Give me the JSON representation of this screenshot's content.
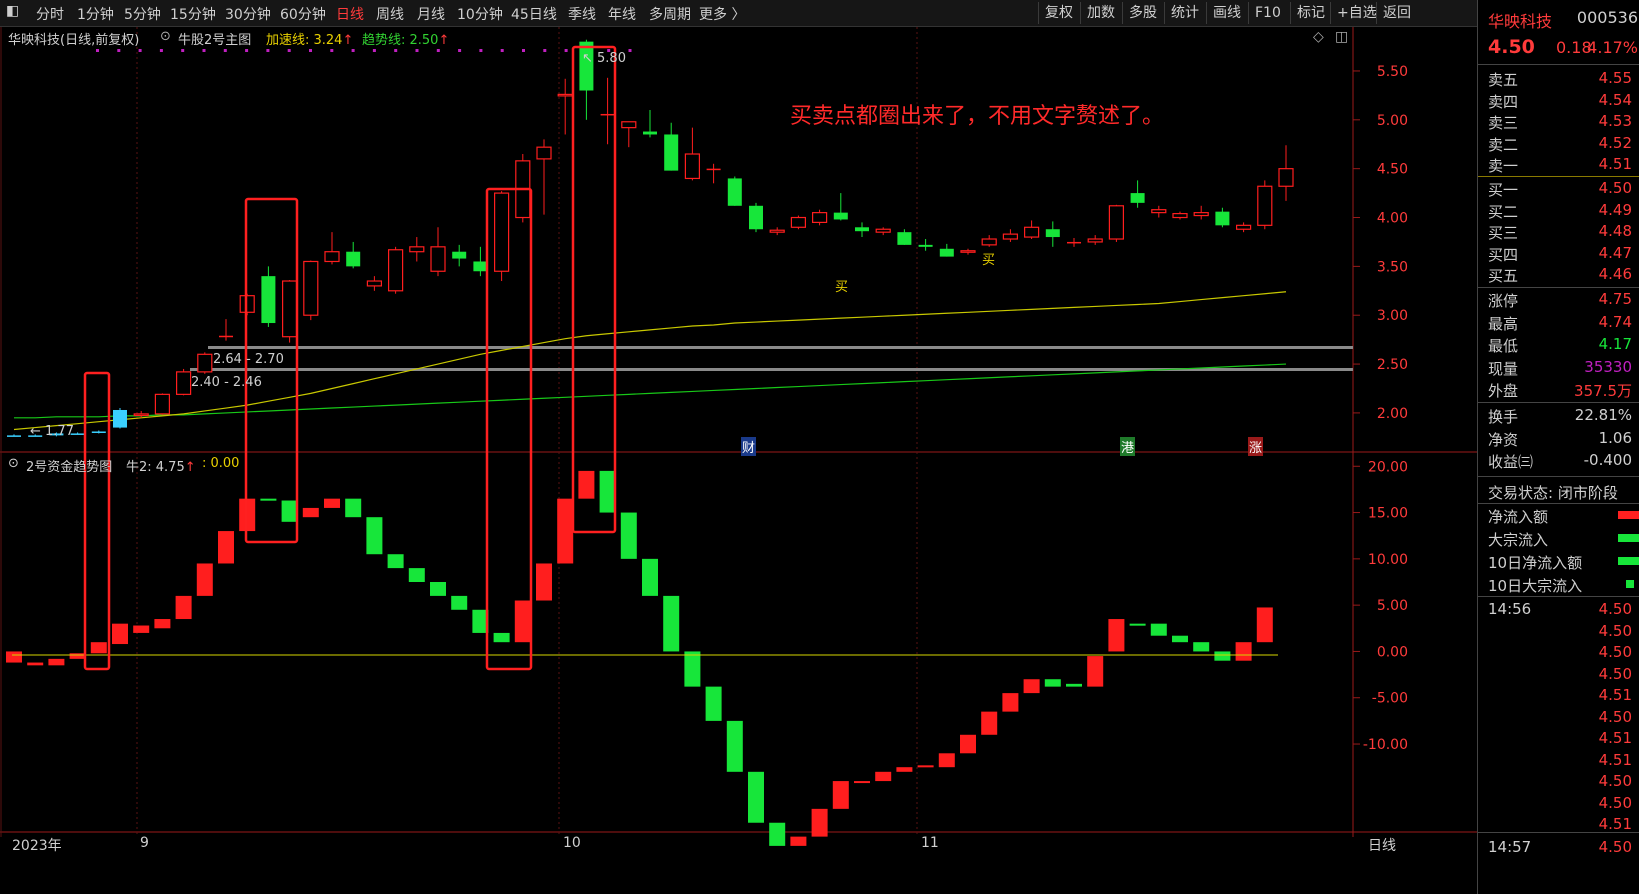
{
  "toolbar": {
    "periods": [
      "分时",
      "1分钟",
      "5分钟",
      "15分钟",
      "30分钟",
      "60分钟",
      "日线",
      "周线",
      "月线",
      "10分钟",
      "45日线",
      "季线",
      "年线",
      "多周期",
      "更多 〉"
    ],
    "active": "日线",
    "right_buttons": [
      "复权",
      "加数",
      "多股",
      "统计",
      "画线",
      "F10",
      "标记",
      "+自选",
      "返回"
    ]
  },
  "main_chart": {
    "title": "华映科技(日线,前复权)",
    "indicator": "牛股2号主图",
    "accel_label": "加速线: 3.24",
    "trend_label": "趋势线: 2.50",
    "annotation": "买卖点都圈出来了，不用文字赘述了。",
    "zone_upper": "2.64 - 2.70",
    "zone_lower": "2.40 - 2.46",
    "high_label": "5.80",
    "low_label": "1.77",
    "buy_marks": [
      "买",
      "买"
    ],
    "event_marks": [
      "财",
      "港",
      "涨"
    ],
    "y_ticks": [
      "5.50",
      "5.00",
      "4.50",
      "4.00",
      "3.50",
      "3.00",
      "2.50",
      "2.00"
    ]
  },
  "sub_chart": {
    "title": "2号资金趋势图",
    "value": "牛2: 4.75",
    "extra": ": 0.00",
    "y_ticks": [
      "20.00",
      "15.00",
      "10.00",
      "5.00",
      "0.00",
      "-5.00",
      "-10.00"
    ]
  },
  "x_axis": {
    "labels": [
      "2023年",
      "9",
      "10",
      "11"
    ],
    "period": "日线"
  },
  "quote": {
    "name": "华映科技",
    "code": "000536",
    "price": "4.50",
    "change": "0.18",
    "pct": "4.17%",
    "asks": [
      [
        "卖五",
        "4.55"
      ],
      [
        "卖四",
        "4.54"
      ],
      [
        "卖三",
        "4.53"
      ],
      [
        "卖二",
        "4.52"
      ],
      [
        "卖一",
        "4.51"
      ]
    ],
    "bids": [
      [
        "买一",
        "4.50"
      ],
      [
        "买二",
        "4.49"
      ],
      [
        "买三",
        "4.48"
      ],
      [
        "买四",
        "4.47"
      ],
      [
        "买五",
        "4.46"
      ]
    ],
    "stats": [
      [
        "涨停",
        "4.75"
      ],
      [
        "最高",
        "4.74"
      ],
      [
        "最低",
        "4.17"
      ],
      [
        "现量",
        "35330"
      ],
      [
        "外盘",
        "357.5万"
      ]
    ],
    "stats2": [
      [
        "换手",
        "22.81%"
      ],
      [
        "净资",
        "1.06"
      ],
      [
        "收益㈢",
        "-0.400"
      ]
    ],
    "status": "交易状态: 闭市阶段",
    "legend": [
      "净流入额",
      "大宗流入",
      "10日净流入额",
      "10日大宗流入"
    ],
    "ticks": [
      [
        "14:56",
        "4.50"
      ],
      [
        "",
        "4.50"
      ],
      [
        "",
        "4.50"
      ],
      [
        "",
        "4.50"
      ],
      [
        "",
        "4.51"
      ],
      [
        "",
        "4.50"
      ],
      [
        "",
        "4.51"
      ],
      [
        "",
        "4.51"
      ],
      [
        "",
        "4.50"
      ],
      [
        "",
        "4.50"
      ],
      [
        "",
        "4.51"
      ]
    ],
    "last_tick": [
      "14:57",
      "4.50"
    ]
  },
  "chart_data": {
    "type": "candlestick",
    "ylim": [
      1.6,
      5.95
    ],
    "candles": [
      [
        1.77,
        1.78,
        1.76,
        1.77
      ],
      [
        1.77,
        1.78,
        1.76,
        1.77
      ],
      [
        1.77,
        1.8,
        1.76,
        1.79
      ],
      [
        1.79,
        1.8,
        1.78,
        1.79
      ],
      [
        1.8,
        1.82,
        1.79,
        1.81
      ],
      [
        1.85,
        2.05,
        1.84,
        2.03
      ],
      [
        1.98,
        2.02,
        1.95,
        1.99
      ],
      [
        1.99,
        2.2,
        1.98,
        2.19
      ],
      [
        2.19,
        2.45,
        2.18,
        2.42
      ],
      [
        2.42,
        2.62,
        2.4,
        2.6
      ],
      [
        2.79,
        2.96,
        2.74,
        2.79
      ],
      [
        3.03,
        3.22,
        3.0,
        3.2
      ],
      [
        3.4,
        3.5,
        2.88,
        2.92
      ],
      [
        2.78,
        3.36,
        2.72,
        3.35
      ],
      [
        3.0,
        3.56,
        2.95,
        3.55
      ],
      [
        3.55,
        3.85,
        3.52,
        3.65
      ],
      [
        3.65,
        3.75,
        3.48,
        3.5
      ],
      [
        3.3,
        3.4,
        3.25,
        3.35
      ],
      [
        3.25,
        3.7,
        3.22,
        3.67
      ],
      [
        3.65,
        3.8,
        3.55,
        3.7
      ],
      [
        3.45,
        3.9,
        3.4,
        3.7
      ],
      [
        3.65,
        3.72,
        3.5,
        3.58
      ],
      [
        3.55,
        3.7,
        3.4,
        3.45
      ],
      [
        3.45,
        4.27,
        3.35,
        4.25
      ],
      [
        4.0,
        4.65,
        3.95,
        4.58
      ],
      [
        4.6,
        4.8,
        4.03,
        4.72
      ],
      [
        5.25,
        5.42,
        4.85,
        5.26
      ],
      [
        5.8,
        5.82,
        5.0,
        5.3
      ],
      [
        5.06,
        5.43,
        4.75,
        5.06
      ],
      [
        4.92,
        4.98,
        4.72,
        4.98
      ],
      [
        4.88,
        5.1,
        4.82,
        4.85
      ],
      [
        4.85,
        4.97,
        4.48,
        4.48
      ],
      [
        4.4,
        4.92,
        4.38,
        4.65
      ],
      [
        4.5,
        4.55,
        4.35,
        4.5
      ],
      [
        4.4,
        4.42,
        4.12,
        4.12
      ],
      [
        4.12,
        4.15,
        3.85,
        3.88
      ],
      [
        3.85,
        3.9,
        3.82,
        3.87
      ],
      [
        3.9,
        4.02,
        3.88,
        4.0
      ],
      [
        3.95,
        4.08,
        3.92,
        4.05
      ],
      [
        4.05,
        4.25,
        3.97,
        3.98
      ],
      [
        3.9,
        3.95,
        3.8,
        3.86
      ],
      [
        3.85,
        3.9,
        3.82,
        3.88
      ],
      [
        3.85,
        3.88,
        3.72,
        3.72
      ],
      [
        3.72,
        3.78,
        3.66,
        3.7
      ],
      [
        3.68,
        3.73,
        3.6,
        3.6
      ],
      [
        3.65,
        3.68,
        3.62,
        3.66
      ],
      [
        3.72,
        3.82,
        3.7,
        3.78
      ],
      [
        3.78,
        3.88,
        3.75,
        3.83
      ],
      [
        3.8,
        3.97,
        3.78,
        3.9
      ],
      [
        3.88,
        3.96,
        3.7,
        3.8
      ],
      [
        3.75,
        3.79,
        3.7,
        3.75
      ],
      [
        3.75,
        3.82,
        3.72,
        3.78
      ],
      [
        3.78,
        4.13,
        3.75,
        4.12
      ],
      [
        4.25,
        4.38,
        4.1,
        4.15
      ],
      [
        4.05,
        4.12,
        4.0,
        4.08
      ],
      [
        4.0,
        4.06,
        3.98,
        4.04
      ],
      [
        4.02,
        4.12,
        3.98,
        4.05
      ],
      [
        4.06,
        4.1,
        3.9,
        3.92
      ],
      [
        3.88,
        3.95,
        3.85,
        3.92
      ],
      [
        3.92,
        4.38,
        3.88,
        4.32
      ],
      [
        4.32,
        4.74,
        4.17,
        4.5
      ]
    ],
    "accel_line": [
      1.83,
      1.85,
      1.87,
      1.89,
      1.91,
      1.93,
      1.95,
      1.97,
      1.99,
      2.02,
      2.05,
      2.08,
      2.12,
      2.16,
      2.2,
      2.25,
      2.3,
      2.35,
      2.4,
      2.45,
      2.5,
      2.55,
      2.6,
      2.64,
      2.68,
      2.72,
      2.76,
      2.79,
      2.81,
      2.83,
      2.85,
      2.87,
      2.89,
      2.9,
      2.92,
      2.93,
      2.94,
      2.95,
      2.96,
      2.97,
      2.98,
      2.99,
      3.0,
      3.01,
      3.02,
      3.03,
      3.04,
      3.05,
      3.06,
      3.07,
      3.08,
      3.09,
      3.1,
      3.11,
      3.12,
      3.14,
      3.16,
      3.18,
      3.2,
      3.22,
      3.24
    ],
    "trend_line": [
      1.95,
      1.95,
      1.96,
      1.96,
      1.96,
      1.97,
      1.97,
      1.98,
      1.98,
      1.99,
      2.0,
      2.01,
      2.02,
      2.03,
      2.04,
      2.05,
      2.06,
      2.07,
      2.08,
      2.09,
      2.1,
      2.11,
      2.12,
      2.13,
      2.14,
      2.15,
      2.16,
      2.17,
      2.18,
      2.19,
      2.2,
      2.21,
      2.22,
      2.23,
      2.24,
      2.25,
      2.26,
      2.27,
      2.28,
      2.29,
      2.3,
      2.31,
      2.32,
      2.33,
      2.34,
      2.35,
      2.36,
      2.37,
      2.38,
      2.39,
      2.4,
      2.41,
      2.42,
      2.43,
      2.44,
      2.45,
      2.46,
      2.47,
      2.48,
      2.49,
      2.5
    ],
    "fund_ylim": [
      -19.5,
      21
    ],
    "fund_bars": [
      [
        0,
        -1.2
      ],
      [
        -1.2,
        -1.5
      ],
      [
        -1.5,
        -0.8
      ],
      [
        -0.8,
        -0.2
      ],
      [
        -0.2,
        1.0
      ],
      [
        0.8,
        3.0
      ],
      [
        2.0,
        2.8
      ],
      [
        2.5,
        3.5
      ],
      [
        3.5,
        6.0
      ],
      [
        6.0,
        9.5
      ],
      [
        9.5,
        13.0
      ],
      [
        13.0,
        16.5
      ],
      [
        16.5,
        16.3
      ],
      [
        16.3,
        14.0
      ],
      [
        14.5,
        15.5
      ],
      [
        15.5,
        16.5
      ],
      [
        16.5,
        14.5
      ],
      [
        14.5,
        10.5
      ],
      [
        10.5,
        9.0
      ],
      [
        9.0,
        7.5
      ],
      [
        7.5,
        6.0
      ],
      [
        6.0,
        4.5
      ],
      [
        4.5,
        2.0
      ],
      [
        2.0,
        1.0
      ],
      [
        1.0,
        5.5
      ],
      [
        5.5,
        9.5
      ],
      [
        9.5,
        16.5
      ],
      [
        16.5,
        19.5
      ],
      [
        19.5,
        15.0
      ],
      [
        15.0,
        10.0
      ],
      [
        10.0,
        6.0
      ],
      [
        6.0,
        0.0
      ],
      [
        0.0,
        -3.8
      ],
      [
        -3.8,
        -7.5
      ],
      [
        -7.5,
        -13.0
      ],
      [
        -13.0,
        -18.5
      ],
      [
        -18.5,
        -21.0
      ],
      [
        -21.0,
        -20.0
      ],
      [
        -20.0,
        -17.0
      ],
      [
        -17.0,
        -14.0
      ],
      [
        -14.0,
        -14.2
      ],
      [
        -14.0,
        -13.0
      ],
      [
        -13.0,
        -12.5
      ],
      [
        -12.5,
        -12.3
      ],
      [
        -12.5,
        -11.0
      ],
      [
        -11.0,
        -9.0
      ],
      [
        -9.0,
        -6.5
      ],
      [
        -6.5,
        -4.5
      ],
      [
        -4.5,
        -3.0
      ],
      [
        -3.0,
        -3.8
      ],
      [
        -3.5,
        -3.8
      ],
      [
        -3.8,
        -0.5
      ],
      [
        0.0,
        3.5
      ],
      [
        3.0,
        2.8
      ],
      [
        3.0,
        1.7
      ],
      [
        1.7,
        1.0
      ],
      [
        1.0,
        0.0
      ],
      [
        0.0,
        -1.0
      ],
      [
        -1.0,
        1.0
      ],
      [
        1.0,
        4.75
      ]
    ],
    "fund_colors": "RRRRRRRRRRRRGGRRGGGGGGGGRRRRGGGGGGGGGRRRRRRRRRRRRGGRRGGGGGRRG",
    "boxes": [
      [
        4,
        -1.5,
        3.0,
        6.5
      ],
      [
        12,
        -1.5,
        9.0,
        2.2
      ],
      [
        22,
        -2.0,
        11.0,
        4.0
      ],
      [
        26,
        -1.0,
        13.5,
        9.5
      ]
    ]
  }
}
